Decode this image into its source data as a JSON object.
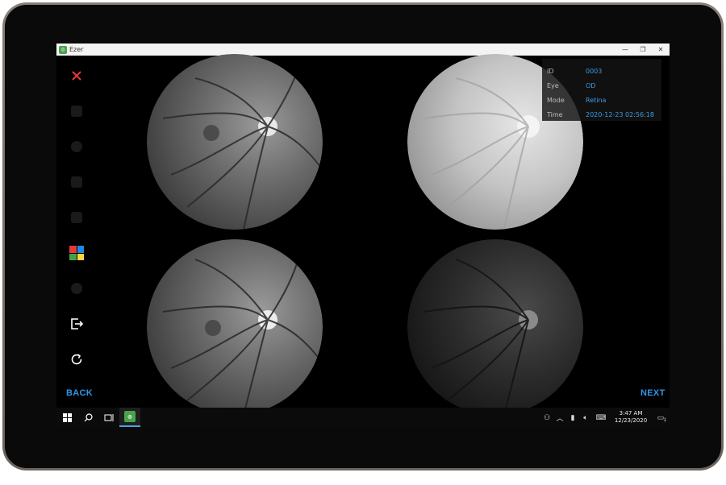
{
  "window": {
    "title": "Ezer",
    "icon_name": "ezer-app-icon",
    "controls": [
      "minimize",
      "restore",
      "close"
    ]
  },
  "toolbar": {
    "items": [
      {
        "name": "close-icon",
        "state": "active",
        "color": "#e53935"
      },
      {
        "name": "save-icon",
        "state": "disabled"
      },
      {
        "name": "brightness-icon",
        "state": "disabled"
      },
      {
        "name": "contrast-icon",
        "state": "disabled"
      },
      {
        "name": "filter-icon",
        "state": "disabled"
      },
      {
        "name": "layout-grid-icon",
        "state": "active",
        "colors": [
          "#e53935",
          "#1e88e5",
          "#43a047",
          "#fdd835"
        ]
      },
      {
        "name": "settings-icon",
        "state": "disabled"
      },
      {
        "name": "export-icon",
        "state": "active"
      },
      {
        "name": "refresh-icon",
        "state": "active"
      }
    ]
  },
  "images": [
    {
      "name": "fundus-top-left",
      "tone": "normal"
    },
    {
      "name": "fundus-top-right",
      "tone": "bright"
    },
    {
      "name": "fundus-bottom-left",
      "tone": "normal"
    },
    {
      "name": "fundus-bottom-right",
      "tone": "dark"
    }
  ],
  "info": {
    "rows": [
      {
        "key": "ID",
        "value": "0003"
      },
      {
        "key": "Eye",
        "value": "OD"
      },
      {
        "key": "Mode",
        "value": "Retina"
      },
      {
        "key": "Time",
        "value": "2020-12-23 02:56:18"
      }
    ]
  },
  "nav": {
    "back_label": "BACK",
    "next_label": "NEXT"
  },
  "taskbar": {
    "time": "3:47 AM",
    "date": "12/23/2020",
    "notification_count": "1"
  },
  "colors": {
    "accent": "#2f95e6",
    "info_value": "#3c9ce6",
    "close": "#e53935"
  }
}
